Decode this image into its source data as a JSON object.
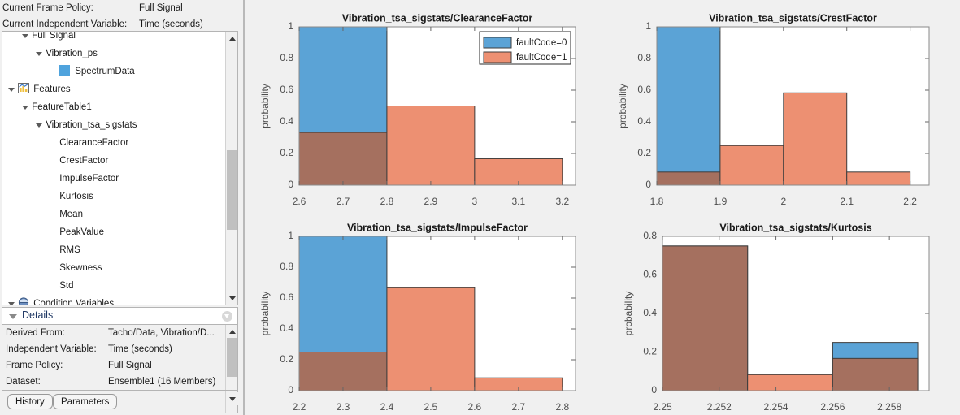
{
  "header": {
    "rows": [
      {
        "label": "Current Frame Policy:",
        "value": "Full Signal"
      },
      {
        "label": "Current Independent Variable:",
        "value": "Time (seconds)"
      }
    ]
  },
  "tree": {
    "items": [
      {
        "label": "Full Signal",
        "indent": 1,
        "twisty": "open",
        "icon": "none",
        "clipped": true
      },
      {
        "label": "Vibration_ps",
        "indent": 2,
        "twisty": "open",
        "icon": "none",
        "clipped": false
      },
      {
        "label": "SpectrumData",
        "indent": 3,
        "twisty": "none",
        "icon": "swatch",
        "clipped": false
      },
      {
        "label": "Features",
        "indent": 0,
        "twisty": "open",
        "icon": "features",
        "clipped": false
      },
      {
        "label": "FeatureTable1",
        "indent": 1,
        "twisty": "open",
        "icon": "none",
        "clipped": false
      },
      {
        "label": "Vibration_tsa_sigstats",
        "indent": 2,
        "twisty": "open",
        "icon": "none",
        "clipped": false
      },
      {
        "label": "ClearanceFactor",
        "indent": 3,
        "twisty": "none",
        "icon": "none",
        "clipped": false
      },
      {
        "label": "CrestFactor",
        "indent": 3,
        "twisty": "none",
        "icon": "none",
        "clipped": false
      },
      {
        "label": "ImpulseFactor",
        "indent": 3,
        "twisty": "none",
        "icon": "none",
        "clipped": false
      },
      {
        "label": "Kurtosis",
        "indent": 3,
        "twisty": "none",
        "icon": "none",
        "clipped": false
      },
      {
        "label": "Mean",
        "indent": 3,
        "twisty": "none",
        "icon": "none",
        "clipped": false
      },
      {
        "label": "PeakValue",
        "indent": 3,
        "twisty": "none",
        "icon": "none",
        "clipped": false
      },
      {
        "label": "RMS",
        "indent": 3,
        "twisty": "none",
        "icon": "none",
        "clipped": false
      },
      {
        "label": "Skewness",
        "indent": 3,
        "twisty": "none",
        "icon": "none",
        "clipped": false
      },
      {
        "label": "Std",
        "indent": 3,
        "twisty": "none",
        "icon": "none",
        "clipped": false
      },
      {
        "label": "Condition Variables",
        "indent": 0,
        "twisty": "open",
        "icon": "condition",
        "clipped": true
      }
    ]
  },
  "details": {
    "title": "Details",
    "rows": [
      {
        "key": "Derived From:",
        "value": "Tacho/Data, Vibration/D..."
      },
      {
        "key": "Independent Variable:",
        "value": "Time (seconds)"
      },
      {
        "key": "Frame Policy:",
        "value": "Full Signal"
      },
      {
        "key": "Dataset:",
        "value": "Ensemble1 (16 Members)"
      }
    ],
    "tabs": [
      {
        "label": "History"
      },
      {
        "label": "Parameters"
      }
    ]
  },
  "colors": {
    "fault0": "#5ba3d6",
    "fault1": "#ed9072",
    "overlap": "#a5705f",
    "edge": "#3c3c3c",
    "background": "#f0f0f0",
    "axes": "#ffffff"
  },
  "chart_data": [
    {
      "type": "bar",
      "title": "Vibration_tsa_sigstats/ClearanceFactor",
      "xlabel": "",
      "ylabel": "probability",
      "xlim": [
        2.6,
        3.23
      ],
      "ylim": [
        0,
        1
      ],
      "xticks": [
        "2.6",
        "2.7",
        "2.8",
        "2.9",
        "3",
        "3.1",
        "3.2"
      ],
      "xtickvals": [
        2.6,
        2.7,
        2.8,
        2.9,
        3.0,
        3.1,
        3.2
      ],
      "yticks": [
        "0",
        "0.2",
        "0.4",
        "0.6",
        "0.8",
        "1"
      ],
      "ytickvals": [
        0,
        0.2,
        0.4,
        0.6,
        0.8,
        1
      ],
      "grid": false,
      "legend": {
        "show": true,
        "position": "top-right",
        "entries": [
          {
            "label": "faultCode=0"
          },
          {
            "label": "faultCode=1"
          }
        ]
      },
      "bins": [
        {
          "x0": 2.6,
          "x1": 2.8,
          "fault0": 1.0,
          "fault1": 0.333
        },
        {
          "x0": 2.8,
          "x1": 3.0,
          "fault0": 0,
          "fault1": 0.5
        },
        {
          "x0": 3.0,
          "x1": 3.2,
          "fault0": 0,
          "fault1": 0.167
        }
      ]
    },
    {
      "type": "bar",
      "title": "Vibration_tsa_sigstats/CrestFactor",
      "xlabel": "",
      "ylabel": "probability",
      "xlim": [
        1.8,
        2.23
      ],
      "ylim": [
        0,
        1
      ],
      "xticks": [
        "1.8",
        "1.9",
        "2",
        "2.1",
        "2.2"
      ],
      "xtickvals": [
        1.8,
        1.9,
        2.0,
        2.1,
        2.2
      ],
      "yticks": [
        "0",
        "0.2",
        "0.4",
        "0.6",
        "0.8",
        "1"
      ],
      "ytickvals": [
        0,
        0.2,
        0.4,
        0.6,
        0.8,
        1
      ],
      "grid": false,
      "legend": {
        "show": false,
        "position": "",
        "entries": []
      },
      "bins": [
        {
          "x0": 1.8,
          "x1": 1.9,
          "fault0": 1.0,
          "fault1": 0.083
        },
        {
          "x0": 1.9,
          "x1": 2.0,
          "fault0": 0,
          "fault1": 0.25
        },
        {
          "x0": 2.0,
          "x1": 2.1,
          "fault0": 0,
          "fault1": 0.583
        },
        {
          "x0": 2.1,
          "x1": 2.2,
          "fault0": 0,
          "fault1": 0.083
        }
      ]
    },
    {
      "type": "bar",
      "title": "Vibration_tsa_sigstats/ImpulseFactor",
      "xlabel": "",
      "ylabel": "probability",
      "xlim": [
        2.2,
        2.83
      ],
      "ylim": [
        0,
        1
      ],
      "xticks": [
        "2.2",
        "2.3",
        "2.4",
        "2.5",
        "2.6",
        "2.7",
        "2.8"
      ],
      "xtickvals": [
        2.2,
        2.3,
        2.4,
        2.5,
        2.6,
        2.7,
        2.8
      ],
      "yticks": [
        "0",
        "0.2",
        "0.4",
        "0.6",
        "0.8",
        "1"
      ],
      "ytickvals": [
        0,
        0.2,
        0.4,
        0.6,
        0.8,
        1
      ],
      "grid": false,
      "legend": {
        "show": false,
        "position": "",
        "entries": []
      },
      "bins": [
        {
          "x0": 2.2,
          "x1": 2.4,
          "fault0": 1.0,
          "fault1": 0.25
        },
        {
          "x0": 2.4,
          "x1": 2.6,
          "fault0": 0,
          "fault1": 0.667
        },
        {
          "x0": 2.6,
          "x1": 2.8,
          "fault0": 0,
          "fault1": 0.083
        }
      ]
    },
    {
      "type": "bar",
      "title": "Vibration_tsa_sigstats/Kurtosis",
      "xlabel": "",
      "ylabel": "probability",
      "xlim": [
        2.25,
        2.2594
      ],
      "ylim": [
        0,
        0.8
      ],
      "xticks": [
        "2.25",
        "2.252",
        "2.254",
        "2.256",
        "2.258"
      ],
      "xtickvals": [
        2.25,
        2.252,
        2.254,
        2.256,
        2.258
      ],
      "yticks": [
        "0",
        "0.2",
        "0.4",
        "0.6",
        "0.8"
      ],
      "ytickvals": [
        0,
        0.2,
        0.4,
        0.6,
        0.8
      ],
      "grid": false,
      "legend": {
        "show": false,
        "position": "",
        "entries": []
      },
      "bins": [
        {
          "x0": 2.25,
          "x1": 2.253,
          "fault0": 0.75,
          "fault1": 0.75
        },
        {
          "x0": 2.253,
          "x1": 2.256,
          "fault0": 0,
          "fault1": 0.083
        },
        {
          "x0": 2.256,
          "x1": 2.259,
          "fault0": 0.25,
          "fault1": 0.167
        }
      ]
    }
  ]
}
